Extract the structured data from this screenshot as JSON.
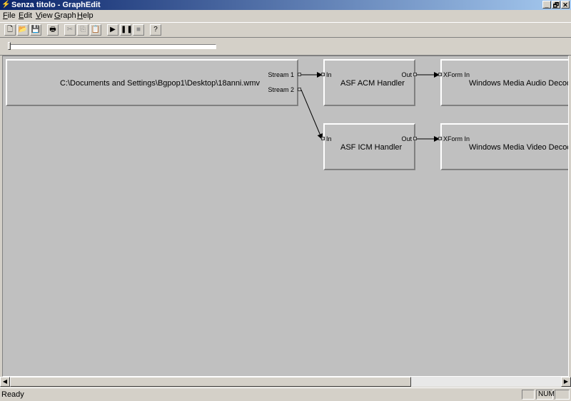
{
  "window": {
    "title": "Senza titolo - GraphEdit",
    "buttons": [
      "_",
      "🗗",
      "✕"
    ]
  },
  "menu": [
    {
      "key": "F",
      "rest": "ile"
    },
    {
      "key": "E",
      "rest": "dit"
    },
    {
      "key": "V",
      "rest": "iew"
    },
    {
      "key": "G",
      "rest": "raph"
    },
    {
      "key": "H",
      "rest": "elp"
    }
  ],
  "toolbar": {
    "new": "🗋",
    "open": "📂",
    "save": "💾",
    "print": "🖶",
    "cut": "✂",
    "copy": "⎘",
    "paste": "📋",
    "play": "▶",
    "pause": "❚❚",
    "stop": "■",
    "help": "?"
  },
  "graph": {
    "source": {
      "name": "C:\\Documents and Settings\\Bgpop1\\Desktop\\18anni.wmv",
      "pin1": "Stream 1",
      "pin2": "Stream 2"
    },
    "acm": {
      "name": "ASF ACM Handler",
      "in": "In",
      "out": "Out"
    },
    "icm": {
      "name": "ASF ICM Handler",
      "in": "In",
      "out": "Out"
    },
    "audio_dec": {
      "name": "Windows Media Audio Decoder",
      "in": "XForm In"
    },
    "video_dec": {
      "name": "Windows Media Video Decoder",
      "in": "XForm In"
    }
  },
  "scroll": {
    "left": "◀",
    "right": "▶"
  },
  "status": {
    "text": "Ready",
    "num": "NUM"
  }
}
